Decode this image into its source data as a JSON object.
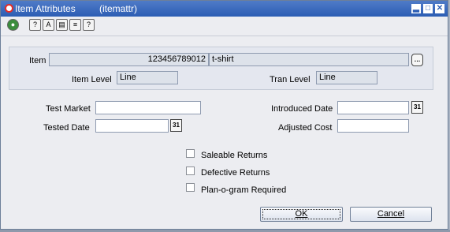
{
  "window": {
    "title": "Item Attributes",
    "code": "(itemattr)",
    "min": "▂",
    "max": "□",
    "close": "✕"
  },
  "toolbar": [
    "globe-icon",
    "help-query-icon",
    "spell-check-icon",
    "copy-icon",
    "notes-icon",
    "help-icon"
  ],
  "item": {
    "label": "Item",
    "number": "123456789012",
    "description": "t-shirt",
    "level_label": "Item Level",
    "level": "Line",
    "tran_level_label": "Tran Level",
    "tran_level": "Line"
  },
  "fields": {
    "test_market_label": "Test Market",
    "test_market": "",
    "tested_date_label": "Tested Date",
    "tested_date": "",
    "introduced_date_label": "Introduced Date",
    "introduced_date": "",
    "adjusted_cost_label": "Adjusted Cost",
    "adjusted_cost": ""
  },
  "checkboxes": [
    {
      "label": "Saleable Returns",
      "checked": false
    },
    {
      "label": "Defective Returns",
      "checked": false
    },
    {
      "label": "Plan-o-gram Required",
      "checked": false
    }
  ],
  "buttons": {
    "ok": "OK",
    "cancel": "Cancel"
  }
}
